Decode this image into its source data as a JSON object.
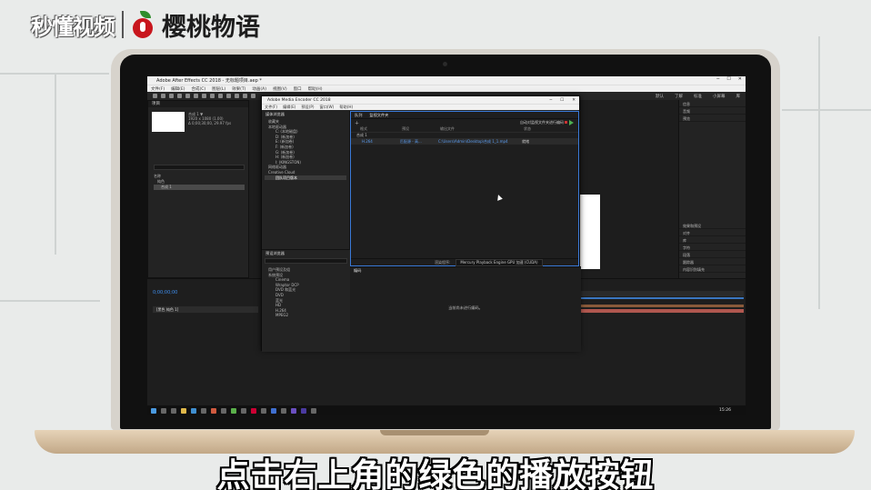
{
  "watermark": {
    "left": "秒懂视频",
    "right": "樱桃物语"
  },
  "ae": {
    "title": "Adobe After Effects CC 2018 - 无标题项目.aep *",
    "menu": [
      "文件(F)",
      "编辑(E)",
      "合成(C)",
      "图层(L)",
      "效果(T)",
      "动画(A)",
      "视图(V)",
      "窗口",
      "帮助(H)"
    ],
    "toolbar_right": [
      "默认",
      "了解",
      "标准",
      "小屏幕",
      "库"
    ],
    "project_tab": "项目",
    "project_info": [
      "合成 1 ▼",
      "1920 x 1080 (1.00)",
      "Δ 0;00;30;00, 29.97 fps"
    ],
    "project_list_header": "名称",
    "project_items": [
      "纯色",
      "合成 1"
    ],
    "right_panel": [
      "信息",
      "音频",
      "预览",
      "效果和预设",
      "对齐",
      "库",
      "字符",
      "段落",
      "跟踪器",
      "内容识别填充"
    ],
    "timecode": "0;00;00;00",
    "layer_name": "[黑色 纯色 1]",
    "taskbar_time": "15:26"
  },
  "me": {
    "title": "Adobe Media Encoder CC 2018",
    "menu": [
      "文件(F)",
      "编辑(E)",
      "预设(P)",
      "窗口(W)",
      "帮助(H)"
    ],
    "browser_tab": "媒体浏览器",
    "browser_tree": [
      {
        "label": "收藏夹",
        "level": 1
      },
      {
        "label": "本地驱动器",
        "level": 1
      },
      {
        "label": "C: (本地磁盘)",
        "level": 2
      },
      {
        "label": "D: (新加卷)",
        "level": 2
      },
      {
        "label": "E: (新加卷)",
        "level": 2
      },
      {
        "label": "F: (新加卷)",
        "level": 2
      },
      {
        "label": "G: (新加卷)",
        "level": 2
      },
      {
        "label": "H: (新加卷)",
        "level": 2
      },
      {
        "label": "I: (KINGSTON)",
        "level": 2
      },
      {
        "label": "网络驱动器",
        "level": 1
      },
      {
        "label": "Creative Cloud",
        "level": 1
      },
      {
        "label": "团队项目版本",
        "level": 2
      }
    ],
    "queue_tabs": [
      "队列",
      "监视文件夹"
    ],
    "auto_encode": "自动对监视文件夹进行编码",
    "queue_columns": [
      "格式",
      "预设",
      "输出文件",
      "状态"
    ],
    "queue_group": "合成 1",
    "queue_item": {
      "format": "H.264",
      "preset": "匹配源 - 高...",
      "output": "C:\\Users\\Admin\\Desktop\\合成 1_1.mp4",
      "status": "就绪"
    },
    "renderer_label": "渲染程序:",
    "renderer_value": "Mercury Playback Engine GPU 加速 (CUDA)",
    "presets_tab": "预设浏览器",
    "presets_items": [
      "用户预设及组",
      "系统预设",
      "Cinema",
      "Wraptor DCP",
      "DVD 和蓝光",
      "DVD",
      "蓝光",
      "HD",
      "H.264",
      "MPEG2"
    ],
    "encoding_tab": "编码",
    "encoding_msg": "当前尚未进行编码。"
  },
  "subtitle": "点击右上角的绿色的播放按钮"
}
